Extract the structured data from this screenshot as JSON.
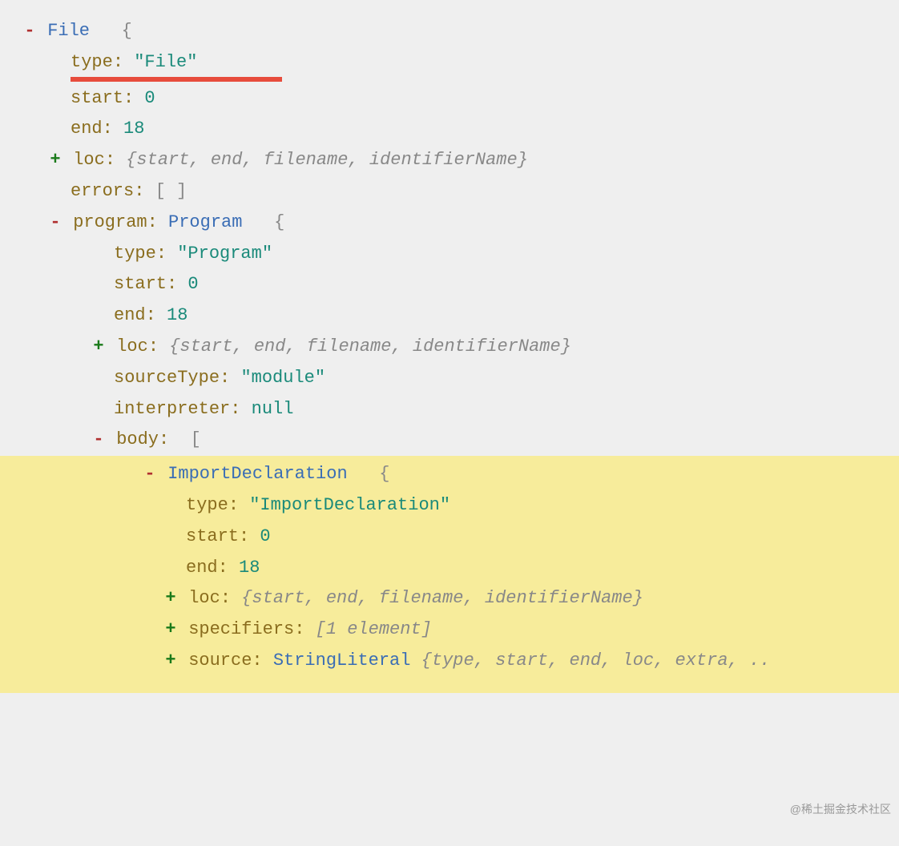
{
  "root": {
    "typeName": "File",
    "type_key": "type",
    "type_val": "\"File\"",
    "start_key": "start",
    "start_val": "0",
    "end_key": "end",
    "end_val": "18",
    "loc_key": "loc",
    "loc_summary": "{start, end, filename, identifierName}",
    "errors_key": "errors",
    "errors_val": "[ ]",
    "program_key": "program",
    "program_typeName": "Program",
    "program": {
      "type_key": "type",
      "type_val": "\"Program\"",
      "start_key": "start",
      "start_val": "0",
      "end_key": "end",
      "end_val": "18",
      "loc_key": "loc",
      "loc_summary": "{start, end, filename, identifierName}",
      "sourceType_key": "sourceType",
      "sourceType_val": "\"module\"",
      "interpreter_key": "interpreter",
      "interpreter_val": "null",
      "body_key": "body",
      "body": {
        "item0_typeName": "ImportDeclaration",
        "item0": {
          "type_key": "type",
          "type_val": "\"ImportDeclaration\"",
          "start_key": "start",
          "start_val": "0",
          "end_key": "end",
          "end_val": "18",
          "loc_key": "loc",
          "loc_summary": "{start, end, filename, identifierName}",
          "specifiers_key": "specifiers",
          "specifiers_summary": "[1 element]",
          "source_key": "source",
          "source_typeName": "StringLiteral",
          "source_summary": "{type, start, end, loc, extra, .."
        }
      }
    }
  },
  "symbols": {
    "open_brace": "{",
    "close_brace": "}",
    "open_bracket": "[",
    "close_bracket": "]",
    "colon": ":"
  },
  "watermark": "@稀土掘金技术社区"
}
